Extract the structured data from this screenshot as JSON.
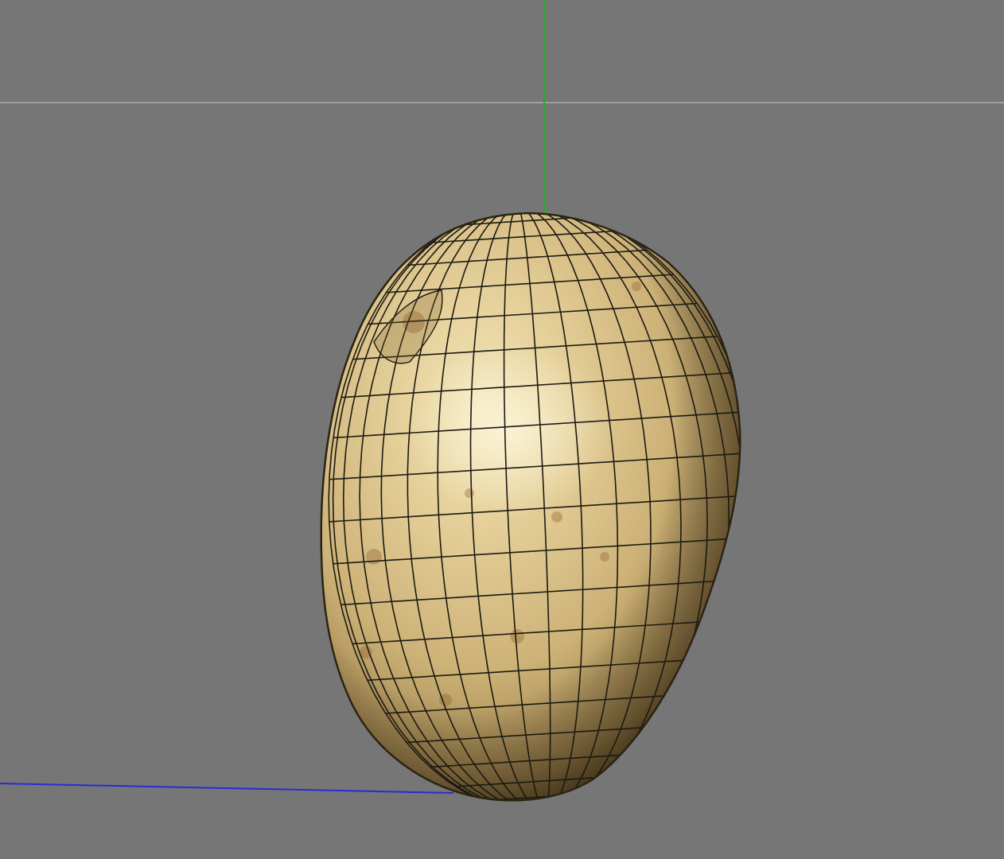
{
  "viewport": {
    "label": "",
    "background": "#767676",
    "horizon_line_color": "#9c9c9c",
    "y_axis_color": "#2aa82a",
    "x_axis_color": "#2a2ad8"
  },
  "object": {
    "icon": "potato-mesh-icon",
    "wireframe_color": "#1c1a12",
    "skin_light": "#ead7a3",
    "skin_mid": "#c8ad72",
    "skin_dark": "#5e4a26"
  }
}
